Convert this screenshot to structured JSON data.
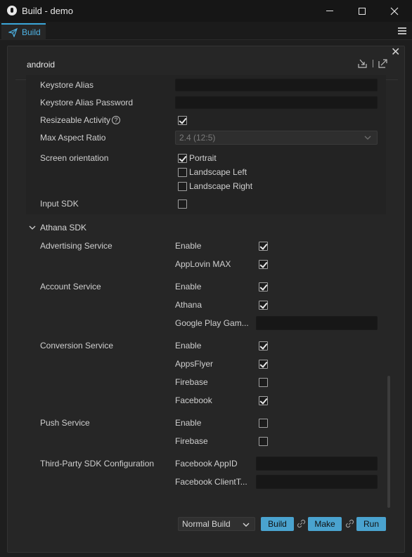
{
  "window": {
    "title": "Build - demo"
  },
  "tab": {
    "label": "Build"
  },
  "panel": {
    "title": "android"
  },
  "fields": {
    "keystore_alias": "Keystore Alias",
    "keystore_alias_password": "Keystore Alias Password",
    "resizeable_activity": "Resizeable Activity",
    "resizeable_activity_checked": true,
    "max_aspect_ratio": "Max Aspect Ratio",
    "max_aspect_ratio_value": "2.4 (12:5)",
    "screen_orientation": "Screen orientation",
    "orientations": [
      {
        "label": "Portrait",
        "checked": true
      },
      {
        "label": "Landscape Left",
        "checked": false
      },
      {
        "label": "Landscape Right",
        "checked": false
      }
    ],
    "input_sdk": "Input SDK",
    "input_sdk_checked": false
  },
  "athana": {
    "section_title": "Athana SDK",
    "services": [
      {
        "name": "Advertising Service",
        "options": [
          {
            "label": "Enable",
            "type": "checkbox",
            "checked": true
          },
          {
            "label": "AppLovin MAX",
            "type": "checkbox",
            "checked": true
          }
        ]
      },
      {
        "name": "Account Service",
        "options": [
          {
            "label": "Enable",
            "type": "checkbox",
            "checked": true
          },
          {
            "label": "Athana",
            "type": "checkbox",
            "checked": true
          },
          {
            "label": "Google Play Gam...",
            "type": "input",
            "value": ""
          }
        ]
      },
      {
        "name": "Conversion Service",
        "options": [
          {
            "label": "Enable",
            "type": "checkbox",
            "checked": true
          },
          {
            "label": "AppsFlyer",
            "type": "checkbox",
            "checked": true
          },
          {
            "label": "Firebase",
            "type": "checkbox",
            "checked": false
          },
          {
            "label": "Facebook",
            "type": "checkbox",
            "checked": true
          }
        ]
      },
      {
        "name": "Push Service",
        "options": [
          {
            "label": "Enable",
            "type": "checkbox",
            "checked": false
          },
          {
            "label": "Firebase",
            "type": "checkbox",
            "checked": false
          }
        ]
      },
      {
        "name": "Third-Party SDK Configuration",
        "options": [
          {
            "label": "Facebook AppID",
            "type": "input",
            "value": ""
          },
          {
            "label": "Facebook ClientT...",
            "type": "input",
            "value": ""
          }
        ]
      }
    ]
  },
  "footer": {
    "build_type": "Normal Build",
    "build_label": "Build",
    "make_label": "Make",
    "run_label": "Run"
  },
  "colors": {
    "accent": "#4aa3cf",
    "tab_accent": "#3ba7d9"
  }
}
